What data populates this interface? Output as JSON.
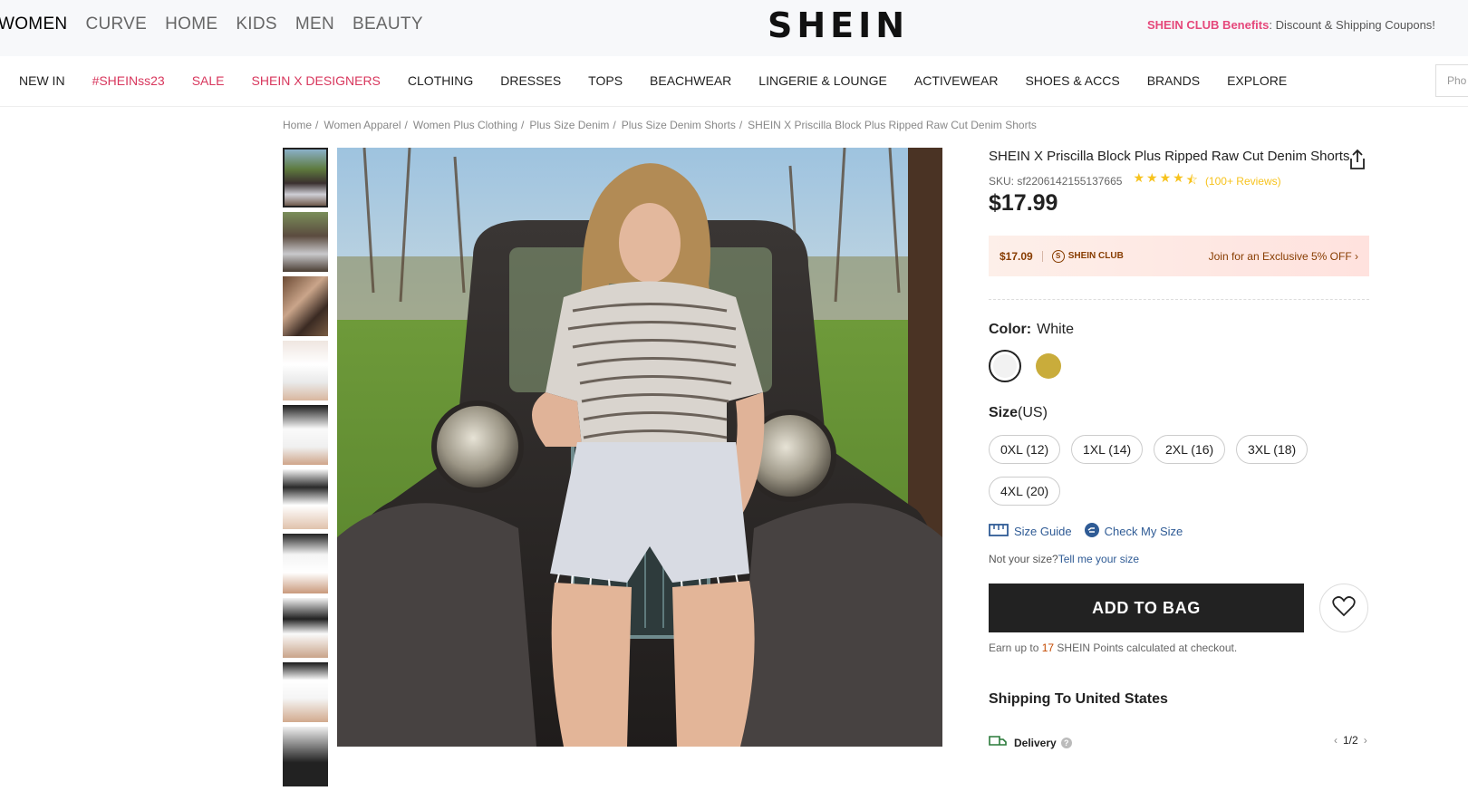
{
  "top_tabs": [
    "WOMEN",
    "CURVE",
    "HOME",
    "KIDS",
    "MEN",
    "BEAUTY"
  ],
  "logo": "SHEIN",
  "club_promo": {
    "name": "SHEIN CLUB Benefits",
    "text": ": Discount & Shipping Coupons!"
  },
  "nav": [
    "NEW IN",
    "#SHEINss23",
    "SALE",
    "SHEIN X DESIGNERS",
    "CLOTHING",
    "DRESSES",
    "TOPS",
    "BEACHWEAR",
    "LINGERIE & LOUNGE",
    "ACTIVEWEAR",
    "SHOES & ACCS",
    "BRANDS",
    "EXPLORE"
  ],
  "search": {
    "placeholder": "Pho"
  },
  "breadcrumb": [
    "Home",
    "Women Apparel",
    "Women Plus Clothing",
    "Plus Size Denim",
    "Plus Size Denim Shorts",
    "SHEIN X Priscilla Block Plus Ripped Raw Cut Denim Shorts"
  ],
  "product": {
    "title": "SHEIN X Priscilla Block Plus Ripped Raw Cut Denim Shorts",
    "sku": "SKU: sf2206142155137665",
    "stars": "★★★★",
    "half_star": "⯪",
    "reviews": "(100+ Reviews)",
    "price": "$17.99",
    "club_price": "$17.09",
    "club_badge": "SHEIN CLUB",
    "club_join": "Join for an Exclusive 5% OFF ›",
    "color_label": "Color:",
    "color_value": "White",
    "size_label": "Size",
    "size_unit": "(US)",
    "sizes": [
      "0XL (12)",
      "1XL (14)",
      "2XL (16)",
      "3XL (18)",
      "4XL (20)"
    ],
    "size_guide": "Size Guide",
    "check_size": "Check My Size",
    "not_your_size": "Not your size?",
    "tell_me": "Tell me your size",
    "add_to_bag": "ADD TO BAG",
    "points_pre": "Earn up to ",
    "points_num": "17",
    "points_post": " SHEIN Points calculated at checkout.",
    "shipping": "Shipping To United States",
    "delivery": "Delivery",
    "pager": "1/2"
  },
  "colors": {
    "pink": "#d8375d",
    "club": "#873c00",
    "bag": "#222222",
    "link": "#2f5b95",
    "star": "#f7c31e"
  }
}
